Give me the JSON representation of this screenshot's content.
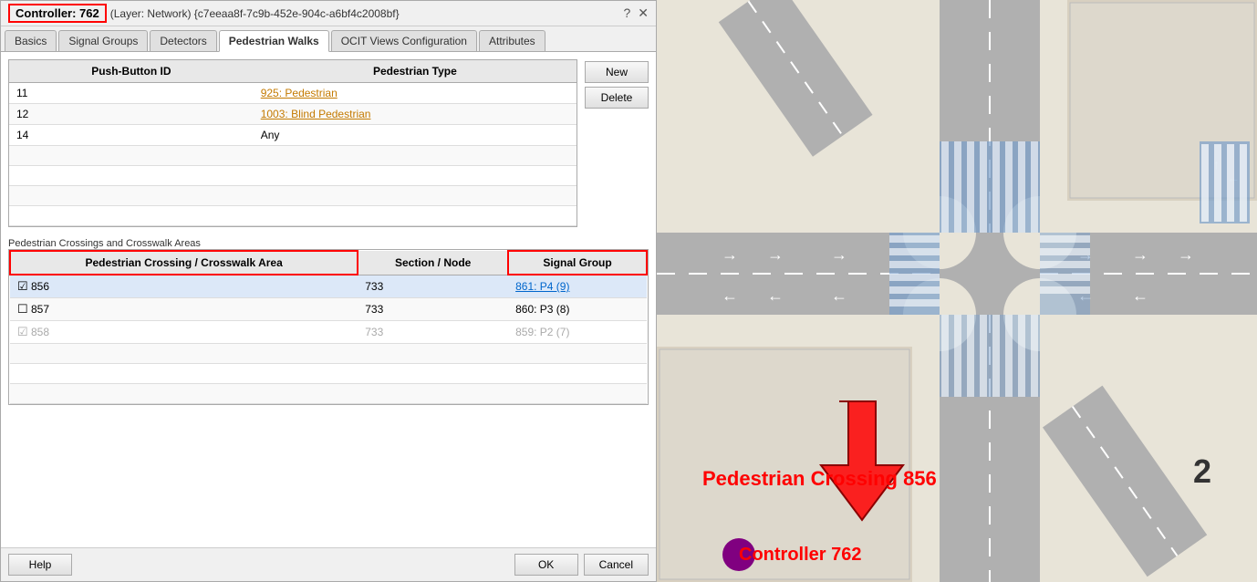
{
  "titleBar": {
    "controller": "Controller: 762",
    "subtitle": "(Layer: Network) {c7eeaa8f-7c9b-452e-904c-a6bf4c2008bf}",
    "helpIcon": "?",
    "closeIcon": "✕"
  },
  "tabs": [
    {
      "label": "Basics",
      "active": false
    },
    {
      "label": "Signal Groups",
      "active": false
    },
    {
      "label": "Detectors",
      "active": false
    },
    {
      "label": "Pedestrian Walks",
      "active": true
    },
    {
      "label": "OCIT Views Configuration",
      "active": false
    },
    {
      "label": "Attributes",
      "active": false
    }
  ],
  "pushButtonTable": {
    "col1": "Push-Button ID",
    "col2": "Pedestrian Type",
    "rows": [
      {
        "id": "11",
        "type": "925: Pedestrian",
        "typeStyle": "orange"
      },
      {
        "id": "12",
        "type": "1003: Blind Pedestrian",
        "typeStyle": "orange"
      },
      {
        "id": "14",
        "type": "Any",
        "typeStyle": "normal"
      }
    ]
  },
  "buttons": {
    "new": "New",
    "delete": "Delete"
  },
  "crosswalkSection": {
    "label": "Pedestrian Crossings and Crosswalk Areas",
    "col1": "Pedestrian Crossing / Crosswalk Area",
    "col2": "Section / Node",
    "col3": "Signal Group",
    "rows": [
      {
        "checkbox": "checked",
        "id": "856",
        "section": "733",
        "signal": "861: P4 (9)",
        "signalStyle": "blue",
        "highlighted": true,
        "dimmed": false
      },
      {
        "checkbox": "unchecked",
        "id": "857",
        "section": "733",
        "signal": "860: P3 (8)",
        "signalStyle": "normal",
        "highlighted": false,
        "dimmed": false
      },
      {
        "checkbox": "dimmed",
        "id": "858",
        "section": "733",
        "signal": "859: P2 (7)",
        "signalStyle": "blue-dim",
        "highlighted": false,
        "dimmed": true
      }
    ]
  },
  "bottomBar": {
    "help": "Help",
    "ok": "OK",
    "cancel": "Cancel"
  },
  "mapAnnotations": {
    "pedestrianLabel": "Pedestrian Crossing 856",
    "controllerLabel": "Controller 762",
    "number": "2"
  }
}
